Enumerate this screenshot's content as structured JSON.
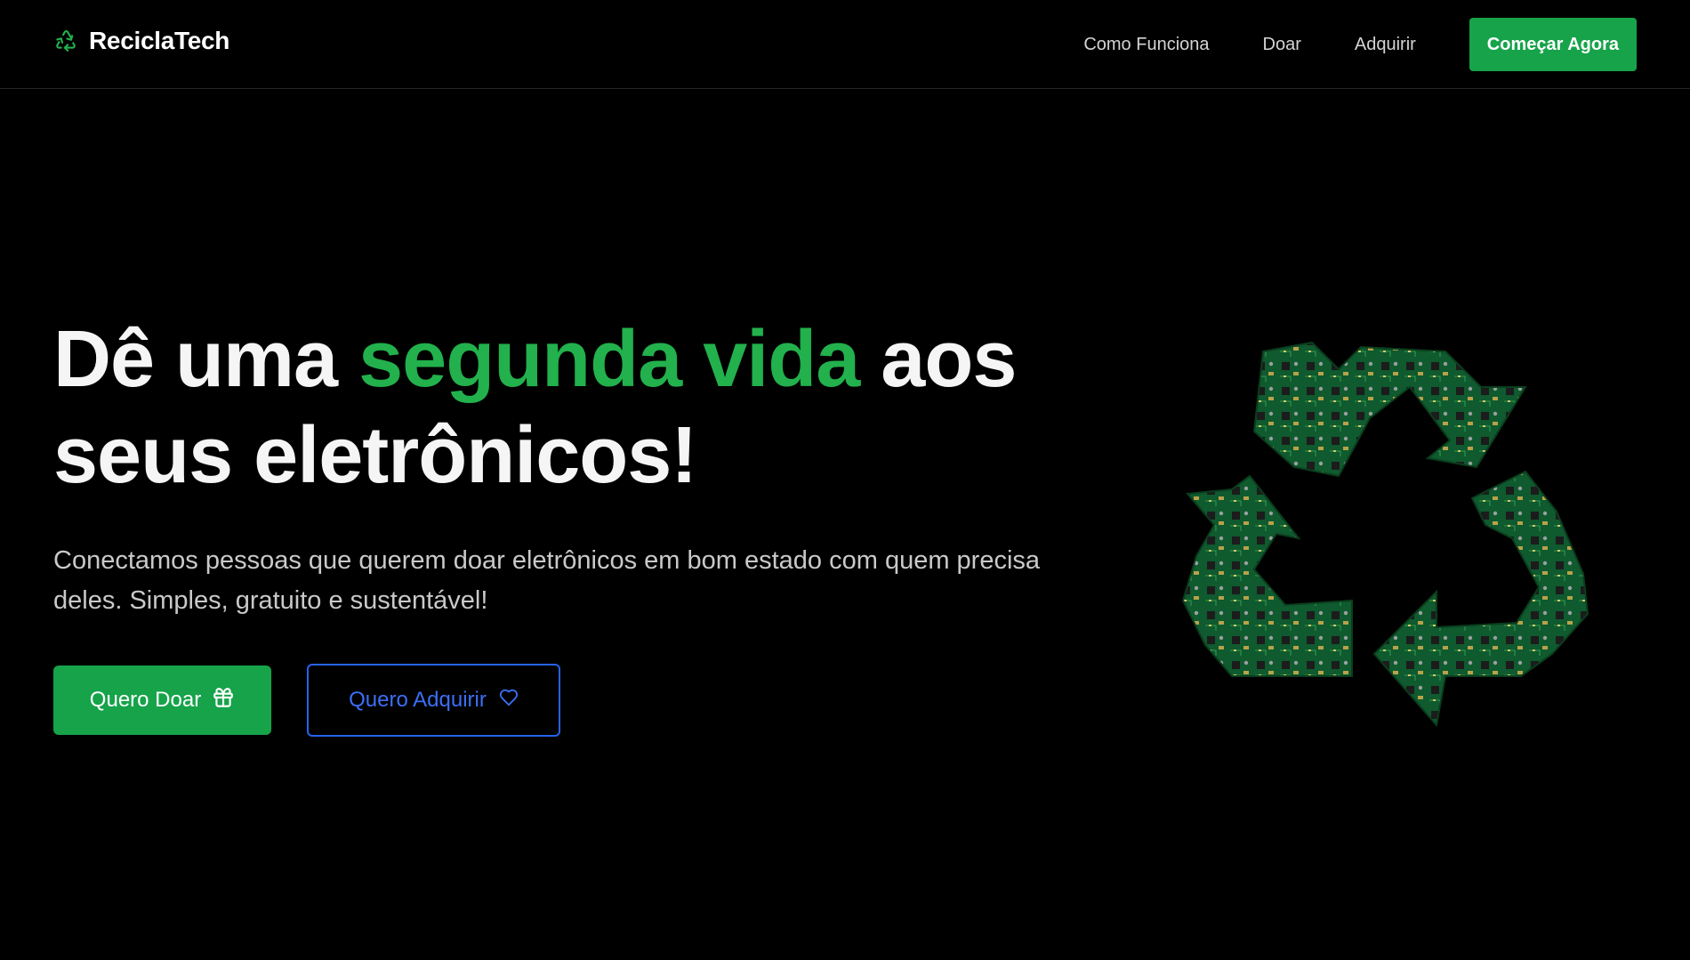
{
  "header": {
    "brand_icon": "recycle-icon",
    "brand_name": "ReciclaTech",
    "nav_links": [
      "Como Funciona",
      "Doar",
      "Adquirir"
    ],
    "cta_label": "Começar Agora"
  },
  "hero": {
    "title_part1": "Dê uma ",
    "title_accent": "segunda vida",
    "title_part2": " aos",
    "title_line2": "seus eletrônicos!",
    "subtitle": "Conectamos pessoas que querem doar eletrônicos em bom estado com quem precisa deles. Simples, gratuito e sustentável!",
    "donate_button": {
      "label": "Quero Doar",
      "icon": "gift-icon"
    },
    "acquire_button": {
      "label": "Quero Adquirir",
      "icon": "heart-icon"
    },
    "illustration": "recycle-symbol-circuit-boards"
  },
  "colors": {
    "background": "#000000",
    "accent_green": "#16a34a",
    "title_green": "#22b14c",
    "outline_blue": "#2563eb"
  }
}
